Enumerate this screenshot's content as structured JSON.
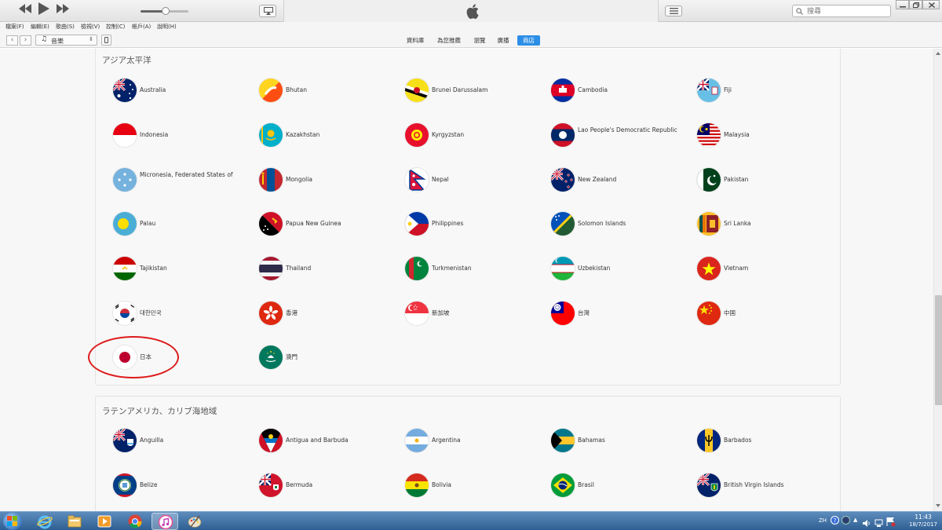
{
  "search": {
    "placeholder": "搜尋"
  },
  "menus": [
    {
      "label": "檔案(F)"
    },
    {
      "label": "編輯(E)"
    },
    {
      "label": "歌曲(S)"
    },
    {
      "label": "檢視(V)"
    },
    {
      "label": "控制(C)"
    },
    {
      "label": "帳戶(A)"
    },
    {
      "label": "說明(H)"
    }
  ],
  "media_selector": {
    "label": "音樂"
  },
  "tabs": [
    {
      "label": "資料庫"
    },
    {
      "label": "為您推薦"
    },
    {
      "label": "瀏覽"
    },
    {
      "label": "廣播"
    },
    {
      "label": "商店",
      "active": true
    }
  ],
  "regions": [
    {
      "title": "アジア太平洋",
      "countries": [
        {
          "name": "Australia",
          "flag": "australia-flag"
        },
        {
          "name": "Bhutan",
          "flag": "bhutan-flag"
        },
        {
          "name": "Brunei Darussalam",
          "flag": "brunei-flag"
        },
        {
          "name": "Cambodia",
          "flag": "cambodia-flag"
        },
        {
          "name": "Fiji",
          "flag": "fiji-flag"
        },
        {
          "name": "Indonesia",
          "flag": "indonesia-flag"
        },
        {
          "name": "Kazakhstan",
          "flag": "kazakhstan-flag"
        },
        {
          "name": "Kyrgyzstan",
          "flag": "kyrgyzstan-flag"
        },
        {
          "name": "Lao People's Democratic Republic",
          "flag": "laos-flag"
        },
        {
          "name": "Malaysia",
          "flag": "malaysia-flag"
        },
        {
          "name": "Micronesia, Federated States of",
          "flag": "micronesia-flag"
        },
        {
          "name": "Mongolia",
          "flag": "mongolia-flag"
        },
        {
          "name": "Nepal",
          "flag": "nepal-flag"
        },
        {
          "name": "New Zealand",
          "flag": "new-zealand-flag"
        },
        {
          "name": "Pakistan",
          "flag": "pakistan-flag"
        },
        {
          "name": "Palau",
          "flag": "palau-flag"
        },
        {
          "name": "Papua New Guinea",
          "flag": "papua-new-guinea-flag"
        },
        {
          "name": "Philippines",
          "flag": "philippines-flag"
        },
        {
          "name": "Solomon Islands",
          "flag": "solomon-islands-flag"
        },
        {
          "name": "Sri Lanka",
          "flag": "sri-lanka-flag"
        },
        {
          "name": "Tajikistan",
          "flag": "tajikistan-flag"
        },
        {
          "name": "Thailand",
          "flag": "thailand-flag"
        },
        {
          "name": "Turkmenistan",
          "flag": "turkmenistan-flag"
        },
        {
          "name": "Uzbekistan",
          "flag": "uzbekistan-flag"
        },
        {
          "name": "Vietnam",
          "flag": "vietnam-flag"
        },
        {
          "name": "대한민국",
          "flag": "south-korea-flag"
        },
        {
          "name": "香港",
          "flag": "hong-kong-flag"
        },
        {
          "name": "新加坡",
          "flag": "singapore-flag"
        },
        {
          "name": "台灣",
          "flag": "taiwan-flag"
        },
        {
          "name": "中国",
          "flag": "china-flag"
        },
        {
          "name": "日本",
          "flag": "japan-flag"
        },
        {
          "name": "澳門",
          "flag": "macau-flag"
        }
      ]
    },
    {
      "title": "ラテンアメリカ、カリブ海地域",
      "countries": [
        {
          "name": "Anguilla",
          "flag": "anguilla-flag"
        },
        {
          "name": "Antigua and Barbuda",
          "flag": "antigua-flag"
        },
        {
          "name": "Argentina",
          "flag": "argentina-flag"
        },
        {
          "name": "Bahamas",
          "flag": "bahamas-flag"
        },
        {
          "name": "Barbados",
          "flag": "barbados-flag"
        },
        {
          "name": "Belize",
          "flag": "belize-flag"
        },
        {
          "name": "Bermuda",
          "flag": "bermuda-flag"
        },
        {
          "name": "Bolivia",
          "flag": "bolivia-flag"
        },
        {
          "name": "Brasil",
          "flag": "brazil-flag"
        },
        {
          "name": "British Virgin Islands",
          "flag": "british-virgin-islands-flag"
        }
      ]
    }
  ],
  "taskbar": {
    "language": "ZH",
    "time": "11:43",
    "date": "18/7/2017",
    "apps": [
      {
        "icon": "internet-explorer-icon"
      },
      {
        "icon": "file-explorer-icon"
      },
      {
        "icon": "media-player-icon"
      },
      {
        "icon": "chrome-icon"
      },
      {
        "icon": "itunes-icon",
        "active": true
      },
      {
        "icon": "paint-icon"
      }
    ]
  },
  "colors": {
    "accent": "#2c8ee6",
    "highlight_circle": "#dd1b1b",
    "taskbar": "#2f5f93"
  }
}
